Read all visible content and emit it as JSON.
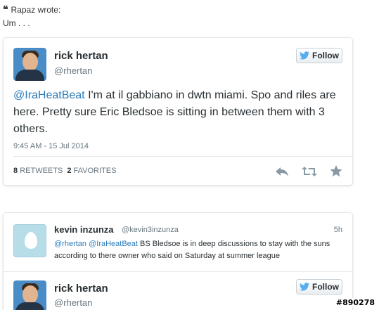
{
  "quote": {
    "author_line": "Rapaz wrote:",
    "body": "Um . . ."
  },
  "tweet": {
    "name": "rick hertan",
    "handle": "@rhertan",
    "follow_label": "Follow",
    "mention": "@IraHeatBeat",
    "text": " I'm at il gabbiano in dwtn miami. Spo and riles are here. Pretty sure Eric Bledsoe is sitting in between them with 3 others.",
    "timestamp": "9:45 AM - 15 Jul 2014",
    "retweets_count": "8",
    "retweets_label": "RETWEETS",
    "favorites_count": "2",
    "favorites_label": "FAVORITES",
    "icons": [
      "reply-icon",
      "retweet-icon",
      "favorite-icon"
    ]
  },
  "reply": {
    "name": "kevin inzunza",
    "handle": "@kevin3inzunza",
    "time": "5h",
    "mention1": "@rhertan",
    "mention2": "@IraHeatBeat",
    "text": " BS Bledsoe is in deep discussions to stay with the suns according to there owner who said on Saturday at summer league"
  },
  "tweet2": {
    "name": "rick hertan",
    "handle": "@rhertan",
    "follow_label": "Follow"
  },
  "watermark": "#890278",
  "colors": {
    "link": "#2b7bb9",
    "twitter_blue": "#55acee",
    "muted": "#66757f"
  }
}
